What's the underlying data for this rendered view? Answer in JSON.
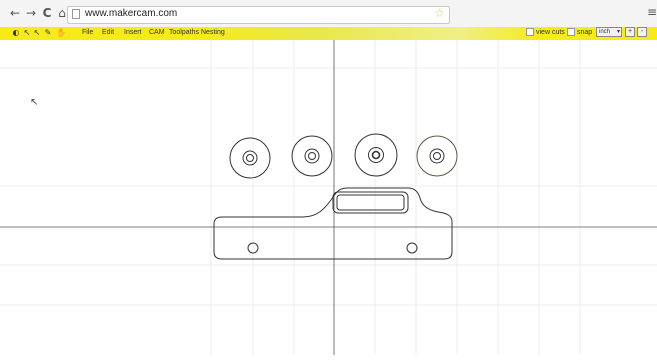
{
  "browser": {
    "back_glyph": "←",
    "forward_glyph": "→",
    "reload_glyph": "C",
    "home_glyph": "⌂",
    "url": "www.makercam.com",
    "star_glyph": "☆",
    "menu_glyph": "≡"
  },
  "toolbar": {
    "background": "#f6ea19",
    "tools": [
      {
        "name": "select-tool-icon",
        "glyph": "◐"
      },
      {
        "name": "arrow-tool-icon",
        "glyph": "↖"
      },
      {
        "name": "node-tool-icon",
        "glyph": "↖"
      },
      {
        "name": "pen-tool-icon",
        "glyph": "✎"
      },
      {
        "name": "hand-tool-icon",
        "glyph": "✋"
      }
    ],
    "menus": [
      "File",
      "Edit",
      "Insert",
      "CAM",
      "Toolpaths",
      "Nesting"
    ],
    "view_cuts_label": "view cuts",
    "snap_label": "snap",
    "unit_value": "inch",
    "zoom_in": "+",
    "zoom_out": "-"
  },
  "canvas": {
    "cursor_glyph": "↖"
  },
  "colors": {
    "grid_line": "#eeeeee",
    "axis_line": "#555555",
    "shape_stroke": "#333333",
    "toolbar_yellow": "#f6ea19"
  }
}
